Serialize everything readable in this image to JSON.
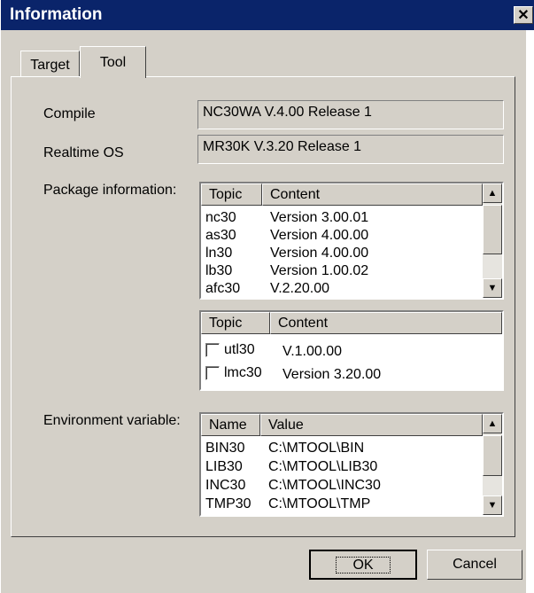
{
  "window": {
    "title": "Information",
    "close_glyph": "✕"
  },
  "tabs": [
    {
      "label": "Target"
    },
    {
      "label": "Tool"
    }
  ],
  "fields": {
    "compile_label": "Compile",
    "compile_value": "NC30WA V.4.00 Release 1",
    "rtos_label": "Realtime OS",
    "rtos_value": "MR30K V.3.20 Release 1",
    "package_label": "Package information:",
    "env_label": "Environment variable:"
  },
  "package_list": {
    "headers": [
      "Topic",
      "Content"
    ],
    "rows": [
      {
        "topic": "nc30",
        "content": "Version 3.00.01"
      },
      {
        "topic": "as30",
        "content": "Version 4.00.00"
      },
      {
        "topic": "ln30",
        "content": "Version 4.00.00"
      },
      {
        "topic": "lb30",
        "content": "Version 1.00.02"
      },
      {
        "topic": "afc30",
        "content": "V.2.20.00"
      }
    ]
  },
  "utility_list": {
    "headers": [
      "Topic",
      "Content"
    ],
    "rows": [
      {
        "topic": "utl30",
        "content": "V.1.00.00",
        "checked": false
      },
      {
        "topic": "lmc30",
        "content": "Version 3.20.00",
        "checked": false
      }
    ]
  },
  "env_list": {
    "headers": [
      "Name",
      "Value"
    ],
    "rows": [
      {
        "name": "BIN30",
        "value": "C:\\MTOOL\\BIN"
      },
      {
        "name": "LIB30",
        "value": "C:\\MTOOL\\LIB30"
      },
      {
        "name": "INC30",
        "value": "C:\\MTOOL\\INC30"
      },
      {
        "name": "TMP30",
        "value": "C:\\MTOOL\\TMP"
      }
    ]
  },
  "buttons": {
    "ok": "OK",
    "cancel": "Cancel"
  },
  "icons": {
    "scroll_up": "scroll-up-arrow-icon",
    "scroll_down": "scroll-down-arrow-icon"
  }
}
